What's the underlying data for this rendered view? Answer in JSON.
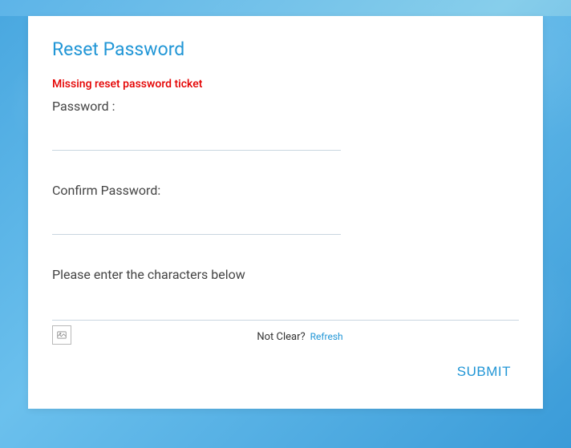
{
  "card": {
    "title": "Reset Password",
    "error": "Missing reset password ticket"
  },
  "fields": {
    "password": {
      "label": "Password :",
      "value": ""
    },
    "confirm": {
      "label": "Confirm Password:",
      "value": ""
    }
  },
  "captcha": {
    "label": "Please enter the characters below",
    "value": "",
    "not_clear": "Not Clear?",
    "refresh": "Refresh",
    "icon_name": "broken-image-icon"
  },
  "actions": {
    "submit": "SUBMIT"
  }
}
